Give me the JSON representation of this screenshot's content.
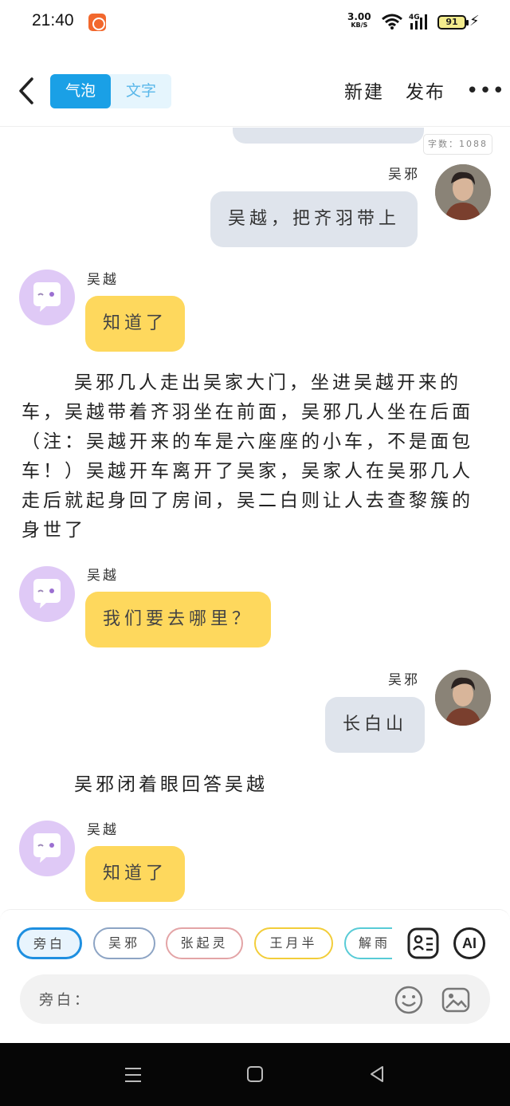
{
  "status_bar": {
    "time": "21:40",
    "net_speed": "3.00",
    "net_unit": "KB/S",
    "network": "4G",
    "battery": "91"
  },
  "nav": {
    "tab_bubble": "气泡",
    "tab_text": "文字",
    "new": "新建",
    "publish": "发布",
    "icons": {
      "back": "chevron-left-icon",
      "more": "more-dots-icon"
    }
  },
  "chat": {
    "word_count": "字数：1088",
    "messages": [
      {
        "name": "吴邪",
        "text": "吴越，把齐羽带上"
      },
      {
        "name": "吴越",
        "text": "知道了"
      },
      {
        "name": "吴越",
        "text": "我们要去哪里？"
      },
      {
        "name": "吴邪",
        "text": "长白山"
      },
      {
        "name": "吴越",
        "text": "知道了"
      }
    ],
    "narration": [
      "吴邪几人走出吴家大门，坐进吴越开来的车，吴越带着齐羽坐在前面，吴邪几人坐在后面（注：吴越开来的车是六座座的小车，不是面包车！）吴越开车离开了吴家，吴家人在吴邪几人走后就起身回了房间，吴二白则让人去查黎簇的身世了",
      "吴邪闭着眼回答吴越"
    ]
  },
  "bottom": {
    "chips": [
      "旁白",
      "吴邪",
      "张起灵",
      "王月半",
      "解雨"
    ],
    "chip_colors": [
      "#1e8fe0",
      "#8da4c4",
      "#e3a4a6",
      "#f2cd3a",
      "#58cbd6"
    ],
    "ai_label": "AI",
    "input_label": "旁白：",
    "icons": [
      "contact-card-icon",
      "ai-icon",
      "emoji-icon",
      "image-icon"
    ]
  }
}
